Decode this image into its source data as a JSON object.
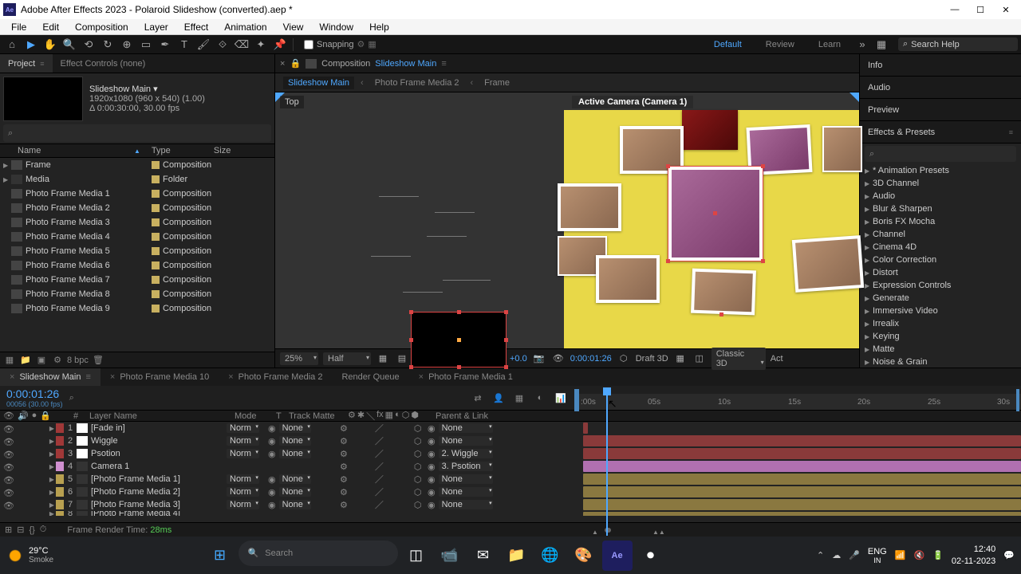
{
  "window": {
    "title": "Adobe After Effects 2023 - Polaroid Slideshow (converted).aep *",
    "ae_icon": "Ae"
  },
  "menu": [
    "File",
    "Edit",
    "Composition",
    "Layer",
    "Effect",
    "Animation",
    "View",
    "Window",
    "Help"
  ],
  "toolbar": {
    "snapping_label": "Snapping",
    "workspaces": [
      "Default",
      "Review",
      "Learn"
    ],
    "search_placeholder": "Search Help"
  },
  "project": {
    "tab_project": "Project",
    "tab_ec": "Effect Controls (none)",
    "comp_name": "Slideshow Main ▾",
    "comp_res": "1920x1080 (960 x 540) (1.00)",
    "comp_dur": "Δ 0:00:30:00, 30.00 fps",
    "cols": {
      "name": "Name",
      "type": "Type",
      "size": "Size"
    },
    "items": [
      {
        "name": "Frame",
        "type": "Composition",
        "twisty": "▶",
        "icon": "comp"
      },
      {
        "name": "Media",
        "type": "Folder",
        "twisty": "▶",
        "icon": "folder"
      },
      {
        "name": "Photo Frame Media 1",
        "type": "Composition",
        "icon": "comp"
      },
      {
        "name": "Photo Frame Media 2",
        "type": "Composition",
        "icon": "comp"
      },
      {
        "name": "Photo Frame Media 3",
        "type": "Composition",
        "icon": "comp"
      },
      {
        "name": "Photo Frame Media 4",
        "type": "Composition",
        "icon": "comp"
      },
      {
        "name": "Photo Frame Media 5",
        "type": "Composition",
        "icon": "comp"
      },
      {
        "name": "Photo Frame Media 6",
        "type": "Composition",
        "icon": "comp"
      },
      {
        "name": "Photo Frame Media 7",
        "type": "Composition",
        "icon": "comp"
      },
      {
        "name": "Photo Frame Media 8",
        "type": "Composition",
        "icon": "comp"
      },
      {
        "name": "Photo Frame Media 9",
        "type": "Composition",
        "icon": "comp"
      }
    ],
    "footer_bpc": "8 bpc"
  },
  "comp": {
    "tab_label": "Composition",
    "tab_active": "Slideshow Main",
    "breadcrumb": [
      "Slideshow Main",
      "Photo Frame Media 2",
      "Frame"
    ],
    "top_label": "Top",
    "cam_label": "Active Camera (Camera 1)",
    "footer": {
      "magnification": "25%",
      "resolution": "Half",
      "exposure": "+0.0",
      "timecode": "0:00:01:26",
      "draft3d": "Draft 3D",
      "renderer": "Classic 3D",
      "act": "Act"
    }
  },
  "rightpanels": {
    "info": "Info",
    "audio": "Audio",
    "preview": "Preview",
    "effects": "Effects & Presets",
    "categories": [
      "* Animation Presets",
      "3D Channel",
      "Audio",
      "Blur & Sharpen",
      "Boris FX Mocha",
      "Channel",
      "Cinema 4D",
      "Color Correction",
      "Distort",
      "Expression Controls",
      "Generate",
      "Immersive Video",
      "Irrealix",
      "Keying",
      "Matte",
      "Noise & Grain"
    ]
  },
  "timeline": {
    "tabs": [
      "Slideshow Main",
      "Photo Frame Media 10",
      "Photo Frame Media 2",
      "Render Queue",
      "Photo Frame Media 1"
    ],
    "timecode": "0:00:01:26",
    "tc_sub": "00056 (30.00 fps)",
    "ruler": [
      ":00s",
      "05s",
      "10s",
      "15s",
      "20s",
      "25s",
      "30s"
    ],
    "cols": {
      "num": "#",
      "layer": "Layer Name",
      "mode": "Mode",
      "t": "T",
      "trkmat": "Track Matte",
      "parent": "Parent & Link"
    },
    "layers": [
      {
        "n": 1,
        "name": "[Fade in]",
        "color": "#a03838",
        "iconbg": "#fff",
        "mode": "Norm",
        "trk": "None",
        "parent": "None",
        "bar": "#8a3a3a",
        "barStart": 2,
        "barEnd": 3
      },
      {
        "n": 2,
        "name": "Wiggle",
        "color": "#a03838",
        "iconbg": "#fff",
        "mode": "Norm",
        "trk": "None",
        "parent": "None",
        "bar": "#8a3a3a",
        "barStart": 2,
        "barEnd": 100
      },
      {
        "n": 3,
        "name": "Psotion",
        "color": "#a03838",
        "iconbg": "#fff",
        "mode": "Norm",
        "trk": "None",
        "parent": "2. Wiggle",
        "bar": "#8a3a3a",
        "barStart": 2,
        "barEnd": 100
      },
      {
        "n": 4,
        "name": "Camera 1",
        "color": "#d090d0",
        "iconbg": "#333",
        "mode": "",
        "trk": "",
        "parent": "3. Psotion",
        "bar": "#b070b0",
        "barStart": 2,
        "barEnd": 100
      },
      {
        "n": 5,
        "name": "[Photo Frame Media 1]",
        "color": "#b8a050",
        "iconbg": "#333",
        "mode": "Norm",
        "trk": "None",
        "parent": "None",
        "bar": "#8a7840",
        "barStart": 2,
        "barEnd": 100
      },
      {
        "n": 6,
        "name": "[Photo Frame Media 2]",
        "color": "#b8a050",
        "iconbg": "#333",
        "mode": "Norm",
        "trk": "None",
        "parent": "None",
        "bar": "#8a7840",
        "barStart": 2,
        "barEnd": 100
      },
      {
        "n": 7,
        "name": "[Photo Frame Media 3]",
        "color": "#b8a050",
        "iconbg": "#333",
        "mode": "Norm",
        "trk": "None",
        "parent": "None",
        "bar": "#8a7840",
        "barStart": 2,
        "barEnd": 100
      }
    ],
    "render_time_label": "Frame Render Time:",
    "render_time": "28ms"
  },
  "taskbar": {
    "temp": "29°C",
    "cond": "Smoke",
    "search": "Search",
    "lang1": "ENG",
    "lang2": "IN",
    "time": "12:40",
    "date": "02-11-2023"
  }
}
